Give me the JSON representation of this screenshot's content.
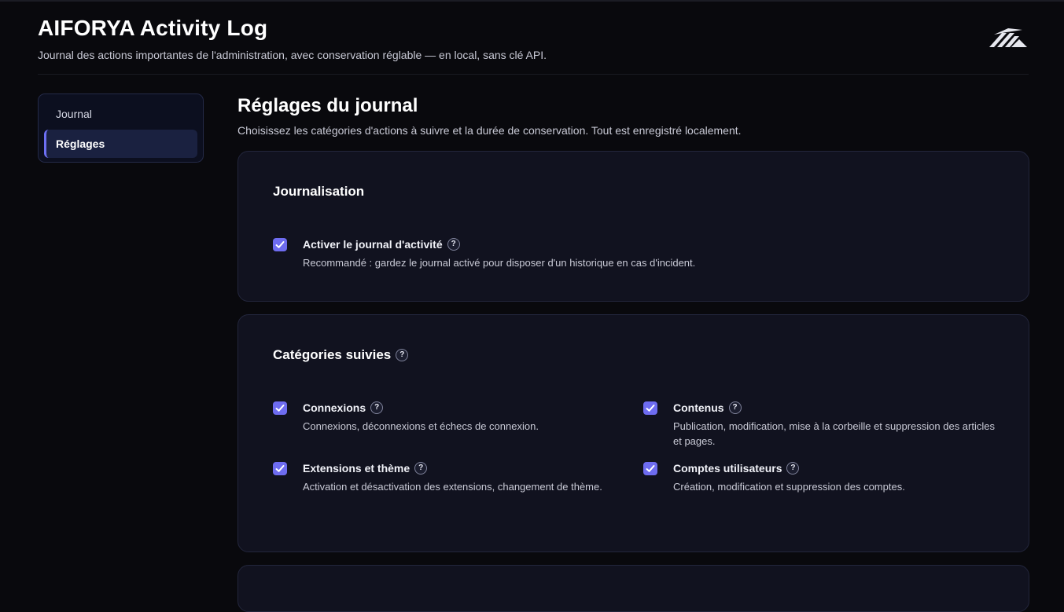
{
  "header": {
    "title": "AIFORYA Activity Log",
    "subtitle": "Journal des actions importantes de l'administration, avec conservation réglable — en local, sans clé API."
  },
  "sidebar": {
    "items": [
      {
        "label": "Journal",
        "active": false
      },
      {
        "label": "Réglages",
        "active": true
      }
    ]
  },
  "main": {
    "title": "Réglages du journal",
    "description": "Choisissez les catégories d'actions à suivre et la durée de conservation. Tout est enregistré localement."
  },
  "logging_card": {
    "title": "Journalisation",
    "option": {
      "label": "Activer le journal d'activité",
      "description": "Recommandé : gardez le journal activé pour disposer d'un historique en cas d'incident.",
      "checked": true
    }
  },
  "categories_card": {
    "title": "Catégories suivies",
    "options": [
      {
        "label": "Connexions",
        "description": "Connexions, déconnexions et échecs de connexion.",
        "checked": true
      },
      {
        "label": "Contenus",
        "description": "Publication, modification, mise à la corbeille et suppression des articles et pages.",
        "checked": true
      },
      {
        "label": "Extensions et thème",
        "description": "Activation et désactivation des extensions, changement de thème.",
        "checked": true
      },
      {
        "label": "Comptes utilisateurs",
        "description": "Création, modification et suppression des comptes.",
        "checked": true
      }
    ]
  },
  "help_symbol": "?",
  "colors": {
    "background": "#09090d",
    "card": "#11121f",
    "accent": "#6e6cf0"
  },
  "icons": {
    "logo": "aiforya-logo-icon",
    "checkbox": "check-icon",
    "help": "question-mark-icon"
  }
}
